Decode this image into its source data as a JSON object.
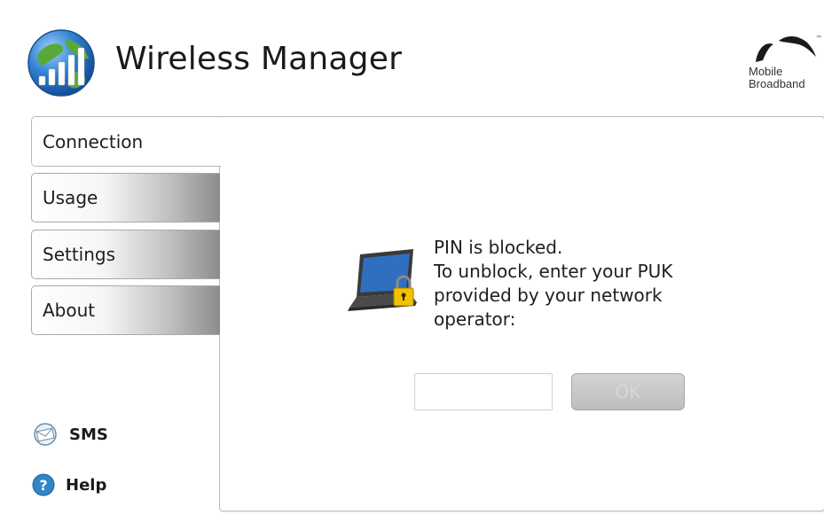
{
  "header": {
    "title": "Wireless Manager",
    "brand": {
      "line1": "Mobile",
      "line2": "Broadband",
      "tm": "™"
    }
  },
  "tabs": [
    {
      "label": "Connection",
      "active": true
    },
    {
      "label": "Usage",
      "active": false
    },
    {
      "label": "Settings",
      "active": false
    },
    {
      "label": "About",
      "active": false
    }
  ],
  "side_links": {
    "sms": "SMS",
    "help": "Help"
  },
  "main": {
    "message_lines": [
      "PIN is blocked.",
      "To unblock, enter your PUK",
      "provided by your network",
      "operator:"
    ],
    "puk_input": {
      "value": "",
      "placeholder": ""
    },
    "ok_label": "OK",
    "ok_enabled": false
  },
  "colors": {
    "panel_border": "#b9b9b9",
    "tab_gradient_dark": "#8c8c8c",
    "ok_disabled_bg": "#c7c7c7",
    "lock_yellow": "#f2c200",
    "help_blue": "#2f86c8"
  },
  "icons": {
    "app_logo": "globe-signal-bars-icon",
    "brand": "bird-wings-icon",
    "sms": "envelope-globe-icon",
    "help": "question-icon",
    "status": "laptop-lock-icon"
  }
}
